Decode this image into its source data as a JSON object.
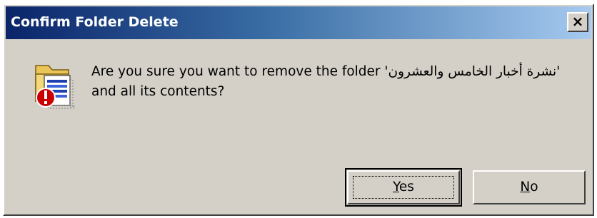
{
  "window": {
    "title": "Confirm Folder Delete",
    "close_glyph": "×"
  },
  "dialog": {
    "icon": "folder-delete-warning-icon",
    "message_prefix": "Are you sure you want to remove the folder '",
    "folder_name": "نشرة أخبار الخامس والعشرون",
    "message_suffix": "' and all its contents?"
  },
  "buttons": {
    "yes": {
      "mnemonic": "Y",
      "rest": "es"
    },
    "no": {
      "mnemonic": "N",
      "rest": "o"
    }
  },
  "colors": {
    "titlebar_start": "#0a246a",
    "titlebar_end": "#a6caf0",
    "dialog_face": "#d4d0c8",
    "warning_red": "#cc0000"
  }
}
